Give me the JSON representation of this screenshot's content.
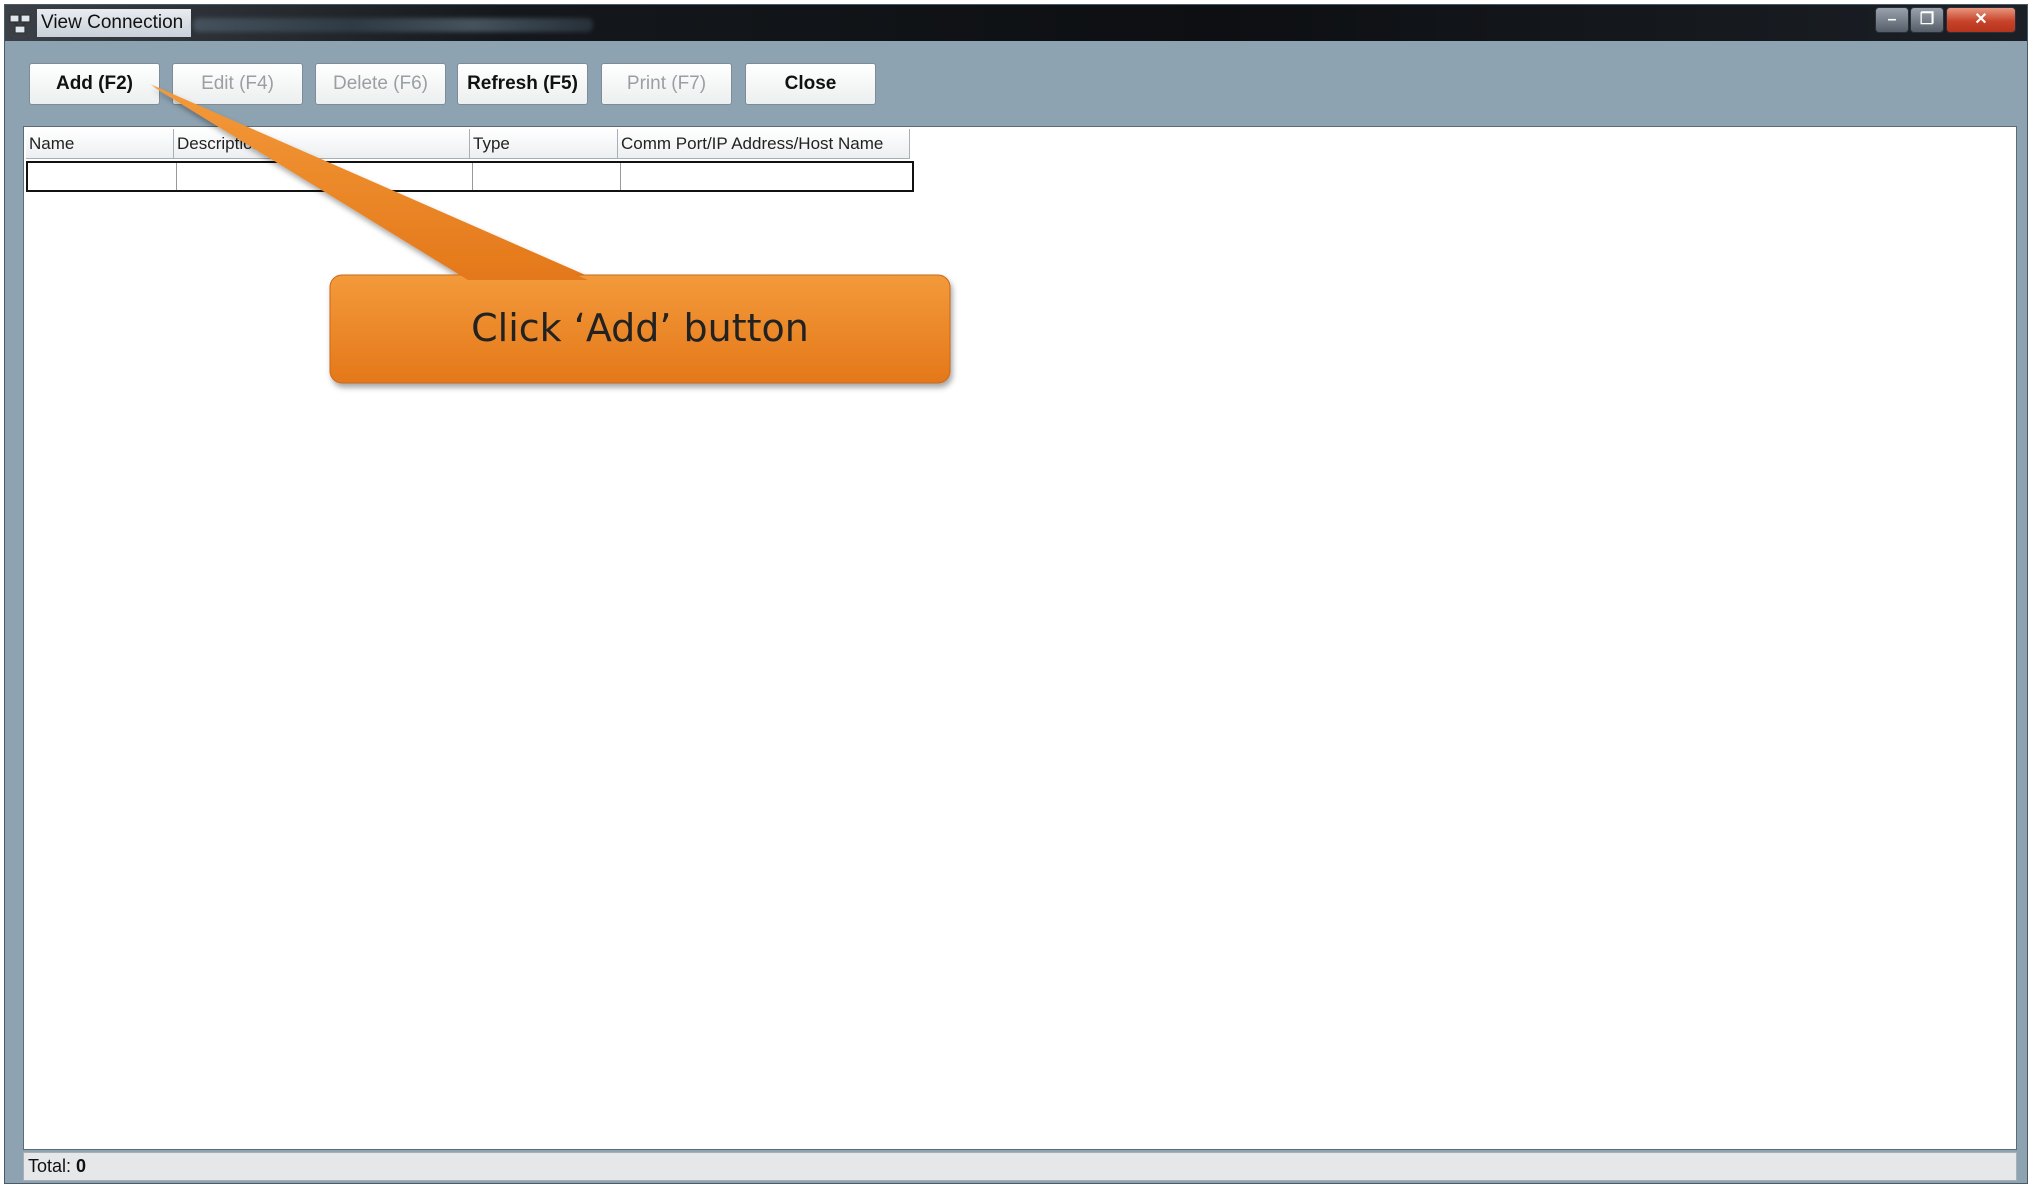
{
  "window": {
    "title": "View Connection"
  },
  "toolbar": [
    {
      "name": "add-button",
      "label": "Add (F2)",
      "enabled": true
    },
    {
      "name": "edit-button",
      "label": "Edit (F4)",
      "enabled": false
    },
    {
      "name": "delete-button",
      "label": "Delete (F6)",
      "enabled": false
    },
    {
      "name": "refresh-button",
      "label": "Refresh (F5)",
      "enabled": true
    },
    {
      "name": "print-button",
      "label": "Print (F7)",
      "enabled": false
    },
    {
      "name": "close-button",
      "label": "Close",
      "enabled": true
    }
  ],
  "grid": {
    "columns": [
      "Name",
      "Description",
      "Type",
      "Comm Port/IP Address/Host Name"
    ]
  },
  "status": {
    "total_label": "Total:",
    "total_value": "0"
  },
  "callout": {
    "text": "Click ‘Add’ button",
    "color": "#ef8a22"
  },
  "window_controls": {
    "minimize_icon": "minimize-icon",
    "maximize_icon": "maximize-icon",
    "close_icon": "close-icon"
  }
}
